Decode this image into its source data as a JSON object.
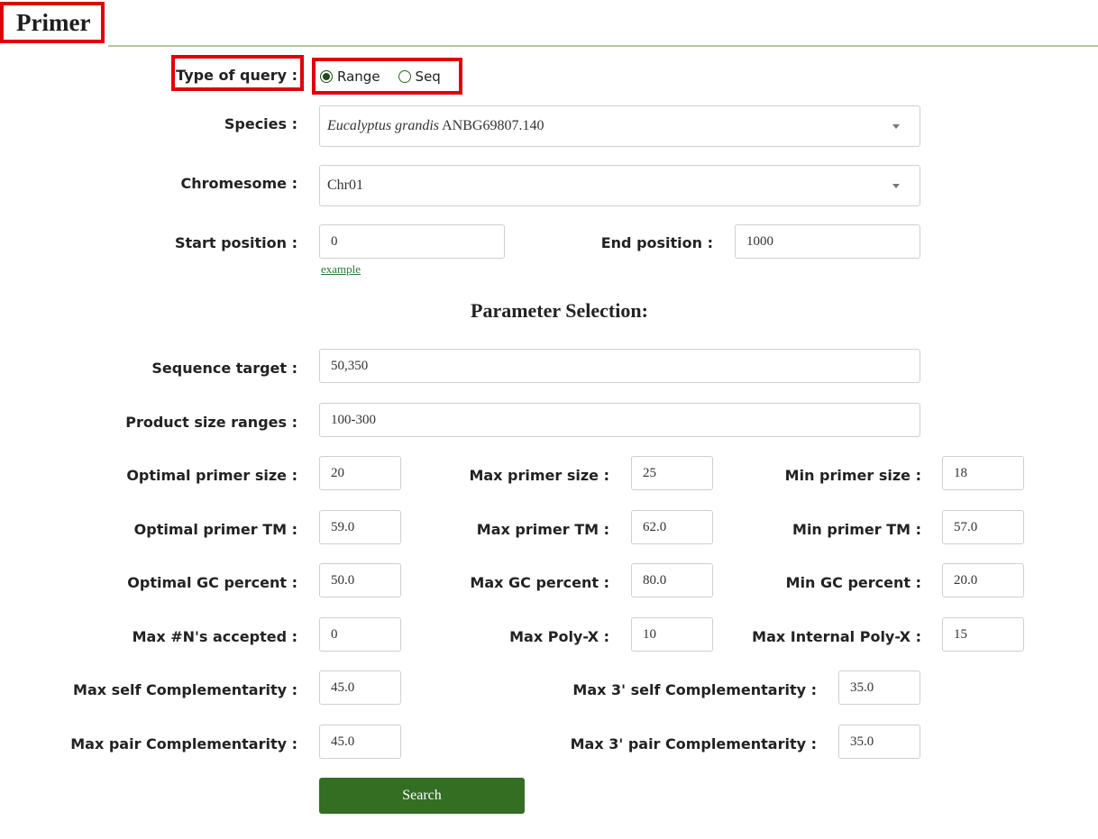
{
  "page": {
    "title": "Primer"
  },
  "query": {
    "type_label": "Type of query :",
    "options": [
      "Range",
      "Seq"
    ],
    "selected": "Range"
  },
  "species": {
    "label": "Species :",
    "value_italic": "Eucalyptus grandis",
    "value_rest": "ANBG69807.140"
  },
  "chromosome": {
    "label": "Chromesome :",
    "value": "Chr01"
  },
  "start": {
    "label": "Start position :",
    "value": "0"
  },
  "end": {
    "label": "End position :",
    "value": "1000"
  },
  "example_link": "example",
  "params": {
    "heading": "Parameter Selection:",
    "sequence_target": {
      "label": "Sequence target :",
      "value": "50,350"
    },
    "product_size": {
      "label": "Product size ranges :",
      "value": "100-300"
    },
    "opt_size": {
      "label": "Optimal primer size :",
      "value": "20"
    },
    "max_size": {
      "label": "Max primer size :",
      "value": "25"
    },
    "min_size": {
      "label": "Min primer size :",
      "value": "18"
    },
    "opt_tm": {
      "label": "Optimal primer TM :",
      "value": "59.0"
    },
    "max_tm": {
      "label": "Max primer TM :",
      "value": "62.0"
    },
    "min_tm": {
      "label": "Min primer TM :",
      "value": "57.0"
    },
    "opt_gc": {
      "label": "Optimal GC percent :",
      "value": "50.0"
    },
    "max_gc": {
      "label": "Max GC percent :",
      "value": "80.0"
    },
    "min_gc": {
      "label": "Min GC percent :",
      "value": "20.0"
    },
    "max_ns": {
      "label": "Max #N's accepted :",
      "value": "0"
    },
    "max_polyx": {
      "label": "Max Poly-X :",
      "value": "10"
    },
    "max_internal_polyx": {
      "label": "Max Internal Poly-X :",
      "value": "15"
    },
    "max_self_comp": {
      "label": "Max self Complementarity :",
      "value": "45.0"
    },
    "max_3_self_comp": {
      "label": "Max 3' self Complementarity :",
      "value": "35.0"
    },
    "max_pair_comp": {
      "label": "Max pair Complementarity :",
      "value": "45.0"
    },
    "max_3_pair_comp": {
      "label": "Max 3' pair Complementarity :",
      "value": "35.0"
    }
  },
  "search_button": "Search",
  "colors": {
    "highlight": "#e0000a",
    "button": "#336e23",
    "link": "#2a7a3a",
    "radio": "#1f4d19"
  }
}
